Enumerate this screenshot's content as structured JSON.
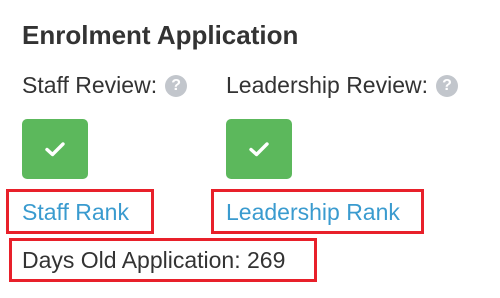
{
  "title": "Enrolment Application",
  "staff_review": {
    "label": "Staff Review:",
    "help_icon": "question-circle-icon",
    "status_icon": "check-icon",
    "status_color": "#5cb85c",
    "rank_link": "Staff Rank"
  },
  "leadership_review": {
    "label": "Leadership Review:",
    "help_icon": "question-circle-icon",
    "status_icon": "check-icon",
    "status_color": "#5cb85c",
    "rank_link": "Leadership Rank"
  },
  "days_old": "Days Old Application: 269",
  "colors": {
    "link": "#3a9bcf",
    "highlight_border": "#e8202a",
    "success": "#5cb85c"
  }
}
